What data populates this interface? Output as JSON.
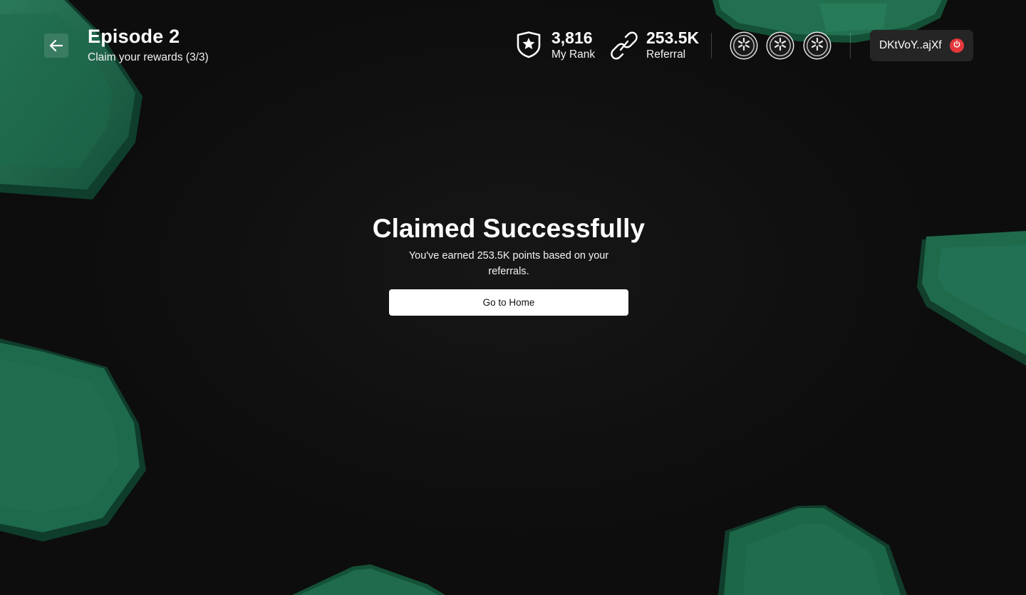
{
  "header": {
    "back_label": "Back",
    "title": "Episode 2",
    "subtitle": "Claim your rewards (3/3)"
  },
  "stats": {
    "rank": {
      "value": "3,816",
      "label": "My Rank"
    },
    "referral": {
      "value": "253.5K",
      "label": "Referral"
    }
  },
  "badges": [
    {
      "icon": "asterisk-badge-icon"
    },
    {
      "icon": "asterisk-badge-icon"
    },
    {
      "icon": "asterisk-badge-icon"
    }
  ],
  "wallet": {
    "address": "DKtVoY..ajXf",
    "power_color": "#e5383b"
  },
  "result": {
    "title": "Claimed Successfully",
    "message": "You've earned 253.5K points based on your referrals.",
    "home_button": "Go to Home"
  },
  "colors": {
    "background": "#0d0d0d",
    "accent_green": "#1f6b4d",
    "button_bg": "#ffffff"
  }
}
